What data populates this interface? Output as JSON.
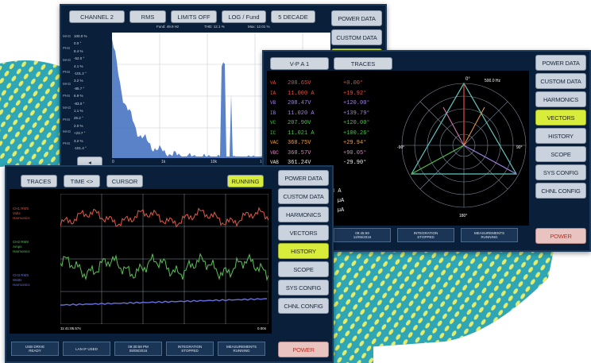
{
  "spectrum_screen": {
    "tabs": [
      "CHANNEL 2",
      "RMS",
      "LIMITS OFF",
      "LOG / Fund",
      "5 DECADE"
    ],
    "header_info": [
      "Fund: 49.9 Hz",
      "THD: 12.1 %",
      "Max: 12.01 %"
    ],
    "side_labels": [
      "MAG",
      "PHS",
      "MAG",
      "PHS",
      "MAG",
      "PHS",
      "MAG",
      "PHS",
      "MAG",
      "PHS"
    ],
    "side_values": [
      "100.0 %",
      "0.0 °",
      "8.4 %",
      "-52.0 °",
      "4.1 %",
      "-101.2 °",
      "3.2 %",
      "-85.7 °",
      "6.9 %",
      "-83.0 °",
      "1.1 %",
      "26.2 °",
      "2.0 %",
      "+23.7 °",
      "3.2 %",
      "-151.4 °"
    ],
    "x_ticks": [
      "0",
      "1k",
      "10k",
      "100k",
      "1M"
    ],
    "nav_button": "◂",
    "right_buttons": [
      "POWER DATA",
      "CUSTOM DATA"
    ]
  },
  "vector_screen": {
    "tabs": [
      "V-P A 1",
      "TRACES"
    ],
    "freq": "500.0 Hz",
    "rows": [
      {
        "label": "VA",
        "value": "208.65V",
        "angle": "+0.00°",
        "color": "#e05040"
      },
      {
        "label": "IA",
        "value": "11.000 A",
        "angle": "+19.92°",
        "color": "#e05040"
      },
      {
        "label": "VB",
        "value": "208.47V",
        "angle": "+120.00°",
        "color": "#a080e0"
      },
      {
        "label": "IB",
        "value": "11.020 A",
        "angle": "+139.79°",
        "color": "#a080e0"
      },
      {
        "label": "VC",
        "value": "207.90V",
        "angle": "+120.00°",
        "color": "#50c050"
      },
      {
        "label": "IC",
        "value": "11.021 A",
        "angle": "+100.26°",
        "color": "#50c050"
      },
      {
        "label": "VAC",
        "value": "360.75V",
        "angle": "+29.94°",
        "color": "#f0a040"
      },
      {
        "label": "VBC",
        "value": "360.57V",
        "angle": "+90.05°",
        "color": "#e080c0"
      },
      {
        "label": "VAB",
        "value": "361.24V",
        "angle": "-29.90°",
        "color": "#f0f0f0"
      }
    ],
    "summary": [
      "11.023 A",
      "3.2 µA",
      "4.2 µA"
    ],
    "polar_labels": {
      "top": "0°",
      "left": "-90°",
      "right": "90°",
      "bottom": "180°"
    },
    "status": [
      [
        "LAN",
        "CONNECTED"
      ],
      [
        "09:45:59",
        "12/05/2016"
      ],
      [
        "INTEGRATION",
        "STOPPED"
      ],
      [
        "MEASUREMENTS",
        "RUNNING"
      ]
    ],
    "right_buttons": [
      "POWER DATA",
      "CUSTOM DATA",
      "HARMONICS",
      "VECTORS",
      "HISTORY",
      "SCOPE",
      "SYS CONFIG",
      "CHNL CONFIG",
      "POWER"
    ],
    "active": "VECTORS"
  },
  "history_screen": {
    "tabs": [
      "TRACES",
      "TIME <>",
      "CURSOR"
    ],
    "running": "RUNNING",
    "legend": [
      {
        "lines": [
          "CH1 RMS",
          "Volts",
          "Harmonics"
        ],
        "color": "#e05040"
      },
      {
        "lines": [
          "CH2 RMS",
          "Amps",
          "Harmonics"
        ],
        "color": "#50c050"
      },
      {
        "lines": [
          "CH3 RMS",
          "Watts",
          "Harmonics"
        ],
        "color": "#6070e0"
      }
    ],
    "x_start": "11:41:05.57s",
    "x_end": "0.00s",
    "status": [
      [
        "USB DRIVE",
        "READY"
      ],
      [
        "LAN IF USED",
        ""
      ],
      [
        "09:30:59 PM",
        "09/05/2016"
      ],
      [
        "INTEGRATION",
        "STOPPED"
      ],
      [
        "MEASUREMENTS",
        "RUNNING"
      ]
    ],
    "right_buttons": [
      "POWER DATA",
      "CUSTOM DATA",
      "HARMONICS",
      "VECTORS",
      "HISTORY",
      "SCOPE",
      "SYS CONFIG",
      "CHNL CONFIG",
      "POWER"
    ],
    "active": "HISTORY"
  },
  "colors": {
    "screen_bg": "#0a1f3a",
    "active_button": "#d8ec3a",
    "pattern_teal": "#2fa6b6",
    "pattern_yellow": "#e4ec6a"
  }
}
